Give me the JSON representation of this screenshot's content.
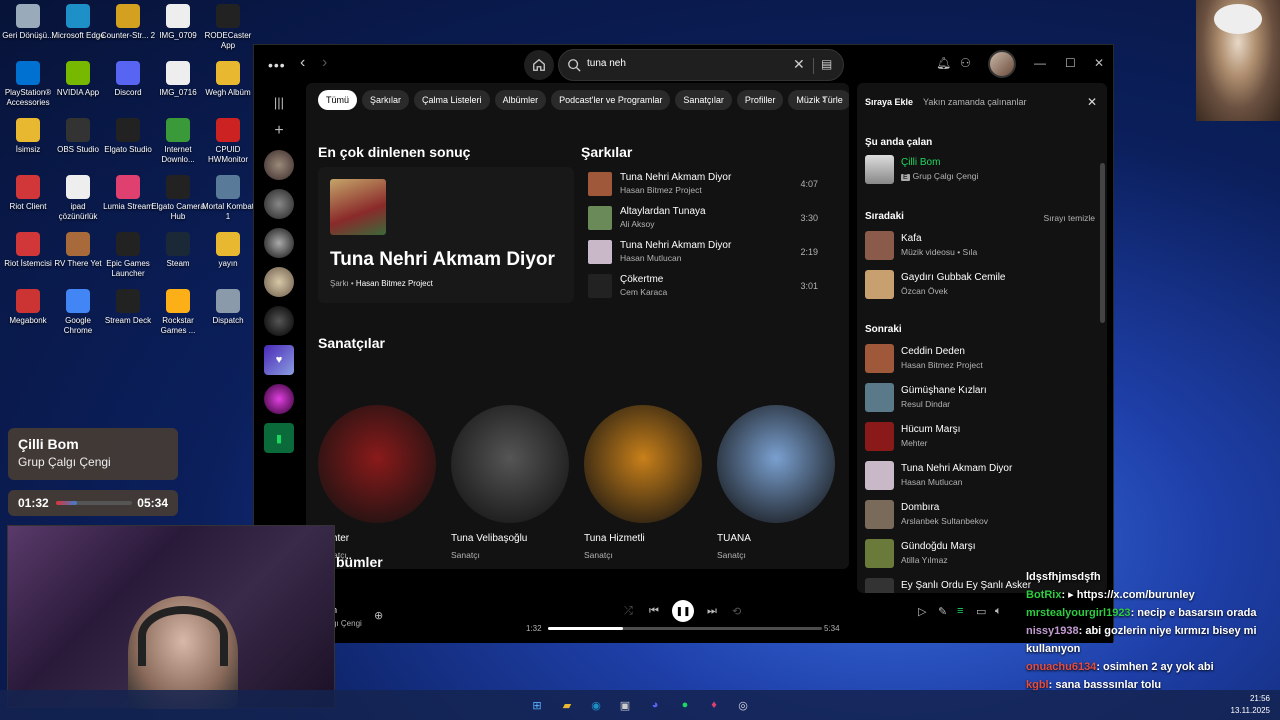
{
  "desktop": {
    "icons": [
      {
        "label": "Geri Dönüşü...",
        "icon": "recycle-bin-icon",
        "color": "#9ab"
      },
      {
        "label": "Microsoft Edge",
        "icon": "edge-icon",
        "color": "#1e90c8"
      },
      {
        "label": "Counter-Str... 2",
        "icon": "cs2-icon",
        "color": "#d4a020"
      },
      {
        "label": "IMG_0709",
        "icon": "video-file-icon",
        "color": "#eee"
      },
      {
        "label": "RODECaster App",
        "icon": "rodecaster-icon",
        "color": "#222"
      },
      {
        "label": "PlayStation® Accessories",
        "icon": "playstation-icon",
        "color": "#0070d1"
      },
      {
        "label": "NVIDIA App",
        "icon": "nvidia-icon",
        "color": "#76b900"
      },
      {
        "label": "Discord",
        "icon": "discord-icon",
        "color": "#5865f2"
      },
      {
        "label": "IMG_0716",
        "icon": "video-file-icon",
        "color": "#eee"
      },
      {
        "label": "Wegh Albüm",
        "icon": "folder-icon",
        "color": "#e8b830"
      },
      {
        "label": "İsimsiz",
        "icon": "folder-icon",
        "color": "#e8b830"
      },
      {
        "label": "OBS Studio",
        "icon": "obs-icon",
        "color": "#333"
      },
      {
        "label": "Elgato Studio",
        "icon": "elgato-icon",
        "color": "#222"
      },
      {
        "label": "Internet Downlo...",
        "icon": "idm-icon",
        "color": "#3a9a3a"
      },
      {
        "label": "CPUID HWMonitor",
        "icon": "hwmonitor-icon",
        "color": "#c22"
      },
      {
        "label": "Riot Client",
        "icon": "riot-icon",
        "color": "#d13639"
      },
      {
        "label": "ipad çözünürlük",
        "icon": "document-icon",
        "color": "#eee"
      },
      {
        "label": "Lumia Stream",
        "icon": "lumia-icon",
        "color": "#e04070"
      },
      {
        "label": "Elgato Camera Hub",
        "icon": "camera-hub-icon",
        "color": "#222"
      },
      {
        "label": "Mortal Kombat 1",
        "icon": "mk1-icon",
        "color": "#5a7a9a"
      },
      {
        "label": "Riot İstemcisi",
        "icon": "riot-icon",
        "color": "#d13639"
      },
      {
        "label": "RV There Yet",
        "icon": "rv-game-icon",
        "color": "#a86a3a"
      },
      {
        "label": "Epic Games Launcher",
        "icon": "epic-icon",
        "color": "#222"
      },
      {
        "label": "Steam",
        "icon": "steam-icon",
        "color": "#1b2838"
      },
      {
        "label": "yayın",
        "icon": "folder-icon",
        "color": "#e8b830"
      },
      {
        "label": "Megabonk",
        "icon": "megabonk-icon",
        "color": "#c33"
      },
      {
        "label": "Google Chrome",
        "icon": "chrome-icon",
        "color": "#4285f4"
      },
      {
        "label": "Stream Deck",
        "icon": "stream-deck-icon",
        "color": "#222"
      },
      {
        "label": "Rockstar Games ...",
        "icon": "rockstar-icon",
        "color": "#fcaf17"
      },
      {
        "label": "Dispatch",
        "icon": "dispatch-icon",
        "color": "#8a9aaa"
      }
    ]
  },
  "window": {
    "search": {
      "value": "tuna neh",
      "placeholder": "Ne çalmak istiyorsun?"
    }
  },
  "main": {
    "chips": [
      "Tümü",
      "Şarkılar",
      "Çalma Listeleri",
      "Albümler",
      "Podcast'ler ve Programlar",
      "Sanatçılar",
      "Profiller",
      "Müzik Türle"
    ],
    "top_result_heading": "En çok dinlenen sonuç",
    "top_result": {
      "title": "Tuna Nehri Akmam Diyor",
      "type": "Şarkı",
      "artist": "Hasan Bitmez Project"
    },
    "songs_heading": "Şarkılar",
    "songs": [
      {
        "title": "Tuna Nehri Akmam Diyor",
        "artist": "Hasan Bitmez Project",
        "duration": "4:07",
        "color": "#a0583a"
      },
      {
        "title": "Altaylardan Tunaya",
        "artist": "Ali Aksoy",
        "duration": "3:30",
        "color": "#6a8a5a"
      },
      {
        "title": "Tuna Nehri Akmam Diyor",
        "artist": "Hasan Mutlucan",
        "duration": "2:19",
        "color": "#c8b8c8"
      },
      {
        "title": "Çökertme",
        "artist": "Cem Karaca",
        "duration": "3:01",
        "color": "#222"
      }
    ],
    "artists_heading": "Sanatçılar",
    "artists": [
      {
        "name": "Mehter",
        "role": "Sanatçı",
        "color": "#8a1a1a"
      },
      {
        "name": "Tuna Velibaşoğlu",
        "role": "Sanatçı",
        "color": "#555"
      },
      {
        "name": "Tuna Hizmetli",
        "role": "Sanatçı",
        "color": "#c8801a"
      },
      {
        "name": "TUANA",
        "role": "Sanatçı",
        "color": "#7aa0d0"
      }
    ],
    "albums_heading": "bümler"
  },
  "queue": {
    "tab_active": "Sıraya Ekle",
    "tab_other": "Yakın zamanda çalınanlar",
    "now_playing_heading": "Şu anda çalan",
    "now_playing": {
      "title": "Çilli Bom",
      "artist": "Grup Çalgı Çengi",
      "badge": "E"
    },
    "next_heading": "Sıradaki",
    "clear_label": "Sırayı temizle",
    "next": [
      {
        "title": "Kafa",
        "artist": "Müzik videosu • Sıla",
        "color": "#8a5a4a"
      },
      {
        "title": "Gaydırı Gubbak Cemile",
        "artist": "Özcan Övek",
        "color": "#c8a070"
      }
    ],
    "later_heading": "Sonraki",
    "later": [
      {
        "title": "Ceddin Deden",
        "artist": "Hasan Bitmez Project",
        "color": "#a0583a"
      },
      {
        "title": "Gümüşhane Kızları",
        "artist": "Resul Dindar",
        "color": "#5a7a8a"
      },
      {
        "title": "Hücum Marşı",
        "artist": "Mehter",
        "color": "#8a1a1a"
      },
      {
        "title": "Tuna Nehri Akmam Diyor",
        "artist": "Hasan Mutlucan",
        "color": "#c8b8c8"
      },
      {
        "title": "Dombıra",
        "artist": "Arslanbek Sultanbekov",
        "color": "#7a6a5a"
      },
      {
        "title": "Gündoğdu Marşı",
        "artist": "Atilla Yılmaz",
        "color": "#6a7a3a"
      },
      {
        "title": "Ey Şanlı Ordu Ey Şanlı Asker",
        "artist": "",
        "color": "#333"
      }
    ]
  },
  "player": {
    "title": "n",
    "artist": "gı Çengi",
    "elapsed": "1:32",
    "total": "5:34",
    "progress": 0.275
  },
  "overlay": {
    "title": "Çilli Bom",
    "artist": "Grup Çalgı Çengi",
    "elapsed": "01:32",
    "total": "05:34",
    "progress": 0.275
  },
  "chat": [
    {
      "user": "ldşsfhjmsdşfh",
      "msg": "",
      "color": "#ffffff"
    },
    {
      "user": "BotRix",
      "msg": ": ▸ https://x.com/burunley",
      "color": "#2ecc40"
    },
    {
      "user": "mrstealyourgirl1923",
      "msg": ": necip e basarsın orada",
      "color": "#2ecc40"
    },
    {
      "user": "nissy1938",
      "msg": ": abi gozlerin niye kırmızı bisey mi kullanıyon",
      "color": "#c39bd3"
    },
    {
      "user": "onuachu6134",
      "msg": ": osimhen 2 ay yok abi",
      "color": "#e74c3c"
    },
    {
      "user": "kgbl",
      "msg": ": sana basssınlar tolu",
      "color": "#e74c3c"
    }
  ],
  "clock": {
    "time": "21:56",
    "date": "13.11.2025"
  }
}
